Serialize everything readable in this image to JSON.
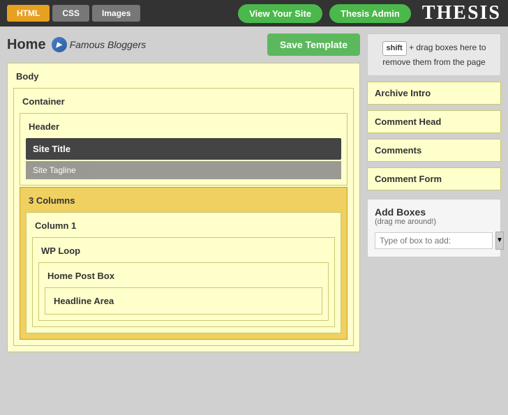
{
  "topbar": {
    "tab_html": "HTML",
    "tab_css": "CSS",
    "tab_images": "Images",
    "btn_view": "View Your Site",
    "btn_thesis": "Thesis Admin",
    "logo": "THESIS"
  },
  "page": {
    "title": "Home",
    "site_name": "Famous Bloggers",
    "save_label": "Save Template"
  },
  "template": {
    "body_label": "Body",
    "container_label": "Container",
    "header_label": "Header",
    "site_title_label": "Site Title",
    "site_tagline_label": "Site Tagline",
    "three_columns_label": "3 Columns",
    "column1_label": "Column 1",
    "wp_loop_label": "WP Loop",
    "home_post_box_label": "Home Post Box",
    "headline_area_label": "Headline Area"
  },
  "right_panel": {
    "shift_label": "shift",
    "remove_text": "+ drag boxes here to remove them from the page",
    "archive_intro": "Archive Intro",
    "comment_head": "Comment Head",
    "comments": "Comments",
    "comment_form": "Comment Form",
    "add_boxes_title": "Add Boxes",
    "add_boxes_sub": "(drag me around!)",
    "type_placeholder": "Type of box to add:"
  }
}
